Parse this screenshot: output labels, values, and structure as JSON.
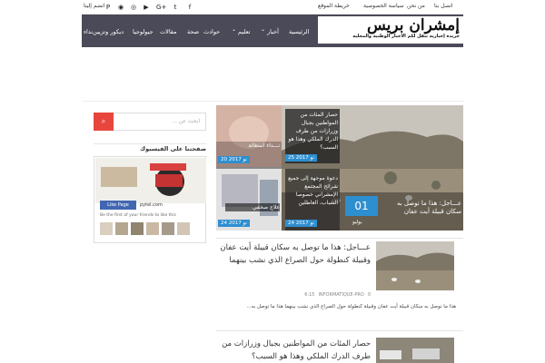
{
  "topbar": {
    "links": [
      "اتصل بنا",
      "من نحن",
      "سياسة الخصوصية",
      "خريطة الموقع",
      "انضم إلينا"
    ],
    "social_icons": [
      "facebook-icon",
      "twitter-icon",
      "google-plus-icon",
      "youtube-icon",
      "instagram-icon",
      "rss-icon",
      "pinterest-icon"
    ],
    "social_glyphs": [
      "f",
      "t",
      "G+",
      "▶",
      "◎",
      "◉",
      "P"
    ]
  },
  "logo": {
    "title": "إمشران بريس",
    "subtitle": "جريدة إخبارية تنقل لكم الأخبار الوطنية والمحلية"
  },
  "nav": {
    "items": [
      "الرئيسية",
      "أخبار",
      "تعليم",
      "حوادث",
      "صحة",
      "مقالات",
      "جيولوجيا",
      "ديكور وتزيين",
      "نداء"
    ],
    "dropdown_glyph": "⌄"
  },
  "slider": {
    "main": {
      "number": "01",
      "month": "يوليو",
      "caption": "عـــاجل: هذا ما توصل به سكان قبيلة أيت عفان"
    },
    "tiles": [
      {
        "caption": "حصار المئات من المواطنين بجبال وزرازات من طرف الدرك الملكي وهذا هو السبب؟",
        "date": "25 نو 2017"
      },
      {
        "caption": "نـــداء استغاثة",
        "date": "20 نو 2017"
      },
      {
        "caption": "دعوة موجهة إلى جميع شرائح المجتمع الإمشراني خصوصا الشباب، العاطلين",
        "date": "24 نو 2017"
      },
      {
        "caption": "علاج صحفي",
        "date": "24 نو 2017"
      }
    ]
  },
  "sidebar": {
    "search_placeholder": "ابحث عن ...",
    "search_icon_glyph": "⌕",
    "fb_title": "صفحتنا على الفيسبوك",
    "fb_like_label": "Like Page",
    "fb_site": "pytel.com",
    "fb_friends": "Be the first of your friends to like this"
  },
  "articles": [
    {
      "title": "عـــاجل: هذا ما توصل به سكان قبيلة أيت عفان وقبيلة كنطولة حول الصراع الذي نشب بينهما",
      "author": "INFORMATIQUE-PRO",
      "comments": "0",
      "time": "6:15",
      "excerpt": "هذا ما توصل به سكان قبيلة أيت عفان وقبيلة كنطولة حول الصراع الذي نشب بينهما هذا ما توصل به..."
    },
    {
      "title": "حصار المئات من المواطنين بجبال وزرازات من طرف الدرك الملكي وهذا هو السبب؟"
    }
  ],
  "colors": {
    "header_bg": "#4a4a58",
    "accent_blue": "#2e8fd0",
    "search_red": "#e8453c"
  }
}
